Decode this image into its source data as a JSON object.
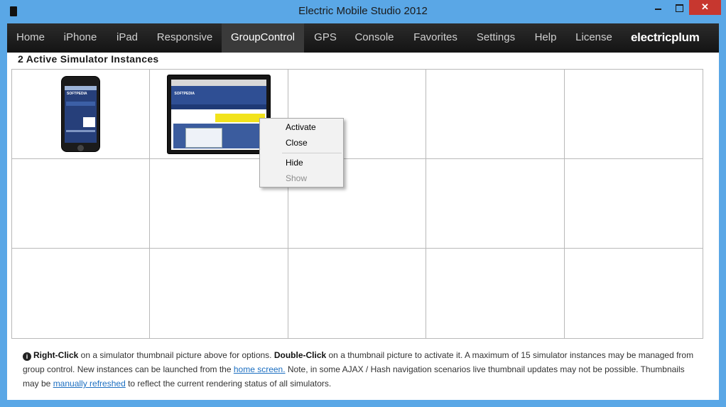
{
  "window": {
    "title": "Electric Mobile Studio 2012",
    "close_glyph": "✕"
  },
  "nav": {
    "items": [
      {
        "label": "Home"
      },
      {
        "label": "iPhone"
      },
      {
        "label": "iPad"
      },
      {
        "label": "Responsive"
      },
      {
        "label": "GroupControl",
        "active": true
      },
      {
        "label": "GPS"
      },
      {
        "label": "Console"
      },
      {
        "label": "Favorites"
      },
      {
        "label": "Settings"
      },
      {
        "label": "Help"
      },
      {
        "label": "License"
      }
    ],
    "logo": "electricplum"
  },
  "main": {
    "heading": "2 Active Simulator Instances",
    "thumbnails": {
      "phone_brand": "SOFTPEDIA",
      "tablet_brand": "SOFTPEDIA"
    }
  },
  "context_menu": {
    "items": [
      {
        "label": "Activate",
        "enabled": true
      },
      {
        "label": "Close",
        "enabled": true
      },
      {
        "label": "Hide",
        "enabled": true
      },
      {
        "label": "Show",
        "enabled": false
      }
    ]
  },
  "footer": {
    "info_glyph": "i",
    "right_click": "Right-Click",
    "text_1": " on a simulator thumbnail picture above for options. ",
    "double_click": "Double-Click",
    "text_2": " on a thumbnail picture to activate it. A maximum of 15 simulator instances may be managed from group control. New instances can be launched from the ",
    "home_link": "home screen.",
    "text_3": " Note, in some AJAX / Hash navigation scenarios live thumbnail updates may not be possible. Thumbnails may be ",
    "refresh_link": "manually refreshed",
    "text_4": " to reflect the current rendering status of all simulators."
  },
  "colors": {
    "window_frame": "#5aa7e6",
    "nav_bg": "#1c1c1c",
    "link": "#1c6fc1",
    "close_button": "#c7372f"
  }
}
